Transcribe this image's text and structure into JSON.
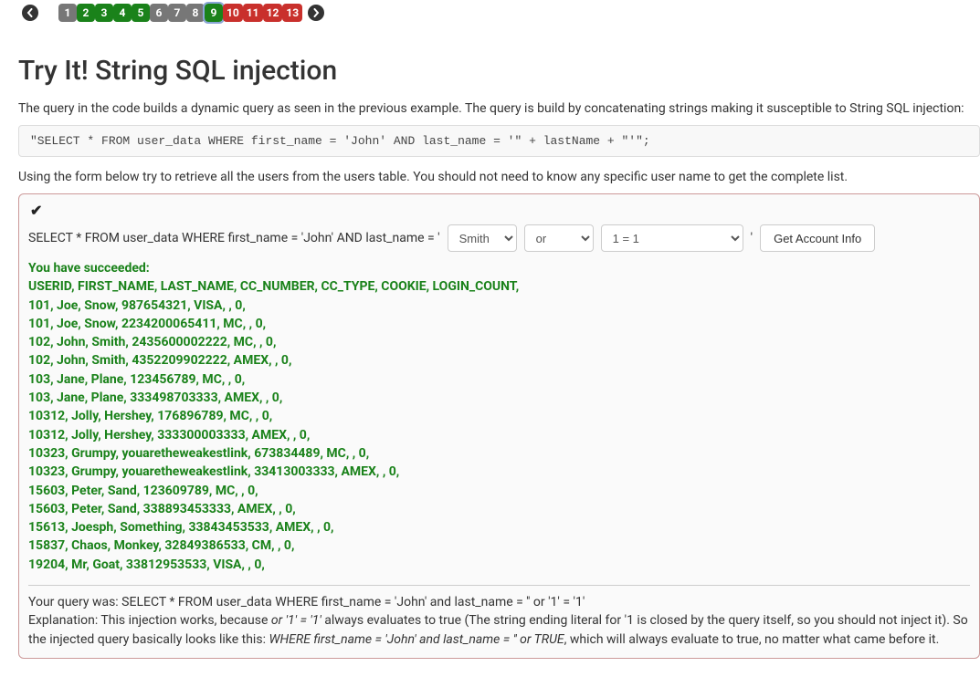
{
  "pagination": {
    "pages": [
      {
        "n": "1",
        "cls": "gray"
      },
      {
        "n": "2",
        "cls": "green"
      },
      {
        "n": "3",
        "cls": "green"
      },
      {
        "n": "4",
        "cls": "green"
      },
      {
        "n": "5",
        "cls": "green"
      },
      {
        "n": "6",
        "cls": "gray"
      },
      {
        "n": "7",
        "cls": "gray"
      },
      {
        "n": "8",
        "cls": "gray"
      },
      {
        "n": "9",
        "cls": "green active"
      },
      {
        "n": "10",
        "cls": "red"
      },
      {
        "n": "11",
        "cls": "red"
      },
      {
        "n": "12",
        "cls": "red"
      },
      {
        "n": "13",
        "cls": "red"
      }
    ]
  },
  "title": "Try It! String SQL injection",
  "intro": "The query in the code builds a dynamic query as seen in the previous example. The query is build by concatenating strings making it susceptible to String SQL injection:",
  "code": "\"SELECT * FROM user_data WHERE first_name = 'John' AND last_name = '\" + lastName + \"'\";",
  "instruction": "Using the form below try to retrieve all the users from the users table. You should not need to know any specific user name to get the complete list.",
  "form": {
    "prefix": "SELECT * FROM user_data WHERE first_name = 'John' AND last_name = '",
    "lastname_selected": "Smith",
    "op_selected": "or",
    "cond_selected": "1 = 1",
    "suffix": "'",
    "button": "Get Account Info"
  },
  "result": {
    "heading": "You have succeeded:",
    "columns": "USERID, FIRST_NAME, LAST_NAME, CC_NUMBER, CC_TYPE, COOKIE, LOGIN_COUNT,",
    "rows": [
      "101, Joe, Snow, 987654321, VISA, , 0,",
      "101, Joe, Snow, 2234200065411, MC, , 0,",
      "102, John, Smith, 2435600002222, MC, , 0,",
      "102, John, Smith, 4352209902222, AMEX, , 0,",
      "103, Jane, Plane, 123456789, MC, , 0,",
      "103, Jane, Plane, 333498703333, AMEX, , 0,",
      "10312, Jolly, Hershey, 176896789, MC, , 0,",
      "10312, Jolly, Hershey, 333300003333, AMEX, , 0,",
      "10323, Grumpy, youaretheweakestlink, 673834489, MC, , 0,",
      "10323, Grumpy, youaretheweakestlink, 33413003333, AMEX, , 0,",
      "15603, Peter, Sand, 123609789, MC, , 0,",
      "15603, Peter, Sand, 338893453333, AMEX, , 0,",
      "15613, Joesph, Something, 33843453533, AMEX, , 0,",
      "15837, Chaos, Monkey, 32849386533, CM, , 0,",
      "19204, Mr, Goat, 33812953533, VISA, , 0,"
    ]
  },
  "explanation": {
    "query_was_label": "Your query was: ",
    "query_was": "SELECT * FROM user_data WHERE first_name = 'John' and last_name = '' or '1' = '1'",
    "line2_prefix": "Explanation: This injection works, because ",
    "line2_ital": "or '1' = '1'",
    "line2_rest": " always evaluates to true (The string ending literal for '1 is closed by the query itself, so you should not inject it). So the injected query basically looks like this: ",
    "line3_ital": "WHERE first_name = 'John' and last_name = '' or TRUE",
    "line3_rest": ", which will always evaluate to true, no matter what came before it."
  }
}
